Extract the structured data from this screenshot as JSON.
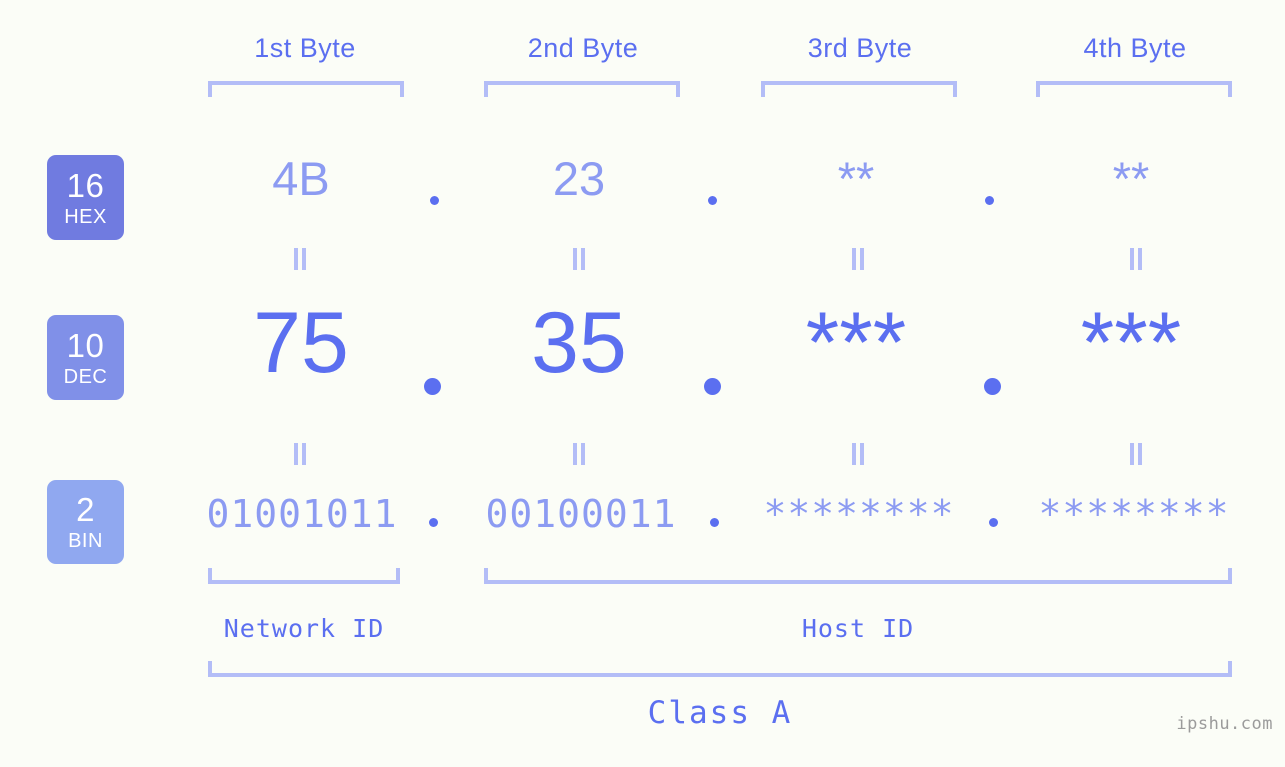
{
  "byte_headers": [
    {
      "label": "1st Byte"
    },
    {
      "label": "2nd Byte"
    },
    {
      "label": "3rd Byte"
    },
    {
      "label": "4th Byte"
    }
  ],
  "rows": [
    {
      "base": "16",
      "base_name": "HEX",
      "badge_color": "#707be0",
      "values": [
        "4B",
        "23",
        "**",
        "**"
      ]
    },
    {
      "base": "10",
      "base_name": "DEC",
      "badge_color": "#8090e8",
      "values": [
        "75",
        "35",
        "***",
        "***"
      ]
    },
    {
      "base": "2",
      "base_name": "BIN",
      "badge_color": "#90a8f0",
      "values": [
        "01001011",
        "00100011",
        "********",
        "********"
      ]
    }
  ],
  "separator": ".",
  "equals_marker": "||",
  "footer": {
    "network_id_label": "Network ID",
    "host_id_label": "Host ID",
    "class_label": "Class A"
  },
  "watermark": "ipshu.com",
  "colors": {
    "background": "#fbfdf7",
    "accent": "#5b6ff0",
    "accent_light": "#8c9bf2",
    "bracket": "#b3bdf7",
    "watermark": "#9b9b9b"
  }
}
